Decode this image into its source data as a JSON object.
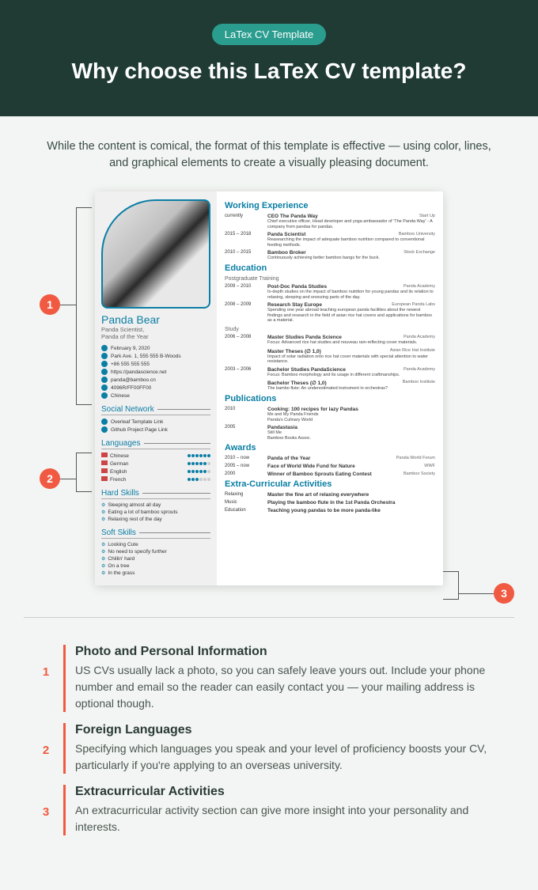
{
  "header": {
    "badge": "LaTex CV Template",
    "headline": "Why choose this LaTeX CV template?"
  },
  "intro": "While the content is comical, the format of this template is effective — using color, lines, and graphical elements to create a visually pleasing document.",
  "cv": {
    "name": "Panda Bear",
    "subtitle": "Panda Scientist,\nPanda of the Year",
    "contacts": [
      "February 9, 2020",
      "Park Ave. 1, 555 555 B-Woods",
      "+86 555 555 555",
      "https://pandascience.net",
      "panda@bamboo.cn",
      "4096R/FF00FF00",
      "Chinese"
    ],
    "sections_left": {
      "social": {
        "title": "Social Network",
        "items": [
          "Overleaf Template Link",
          "Github Project Page Link"
        ]
      },
      "languages": {
        "title": "Languages",
        "items": [
          {
            "name": "Chinese",
            "level": 6
          },
          {
            "name": "German",
            "level": 5
          },
          {
            "name": "English",
            "level": 5
          },
          {
            "name": "French",
            "level": 3
          }
        ]
      },
      "hard": {
        "title": "Hard Skills",
        "items": [
          "Sleeping almost all day",
          "Eating a lot of bamboo sprouts",
          "Relaxing rest of the day"
        ]
      },
      "soft": {
        "title": "Soft Skills",
        "items": [
          "Looking Cute",
          "No need to specify further",
          "Chillin' hard",
          "On a tree",
          "In the grass"
        ]
      }
    },
    "right": {
      "work": {
        "title": "Working Experience",
        "entries": [
          {
            "date": "currently",
            "title": "CEO The Panda Way",
            "org": "Start Up",
            "desc": "Chief executive officer, Head developer and yoga ambassador of 'The Panda Way' - A company from pandas for pandas."
          },
          {
            "date": "2015 – 2018",
            "title": "Panda Scientist",
            "org": "Bamboo University",
            "desc": "Reasearching the impact of adequate bamboo nutrition compared to conventional feeding methods."
          },
          {
            "date": "2010 – 2015",
            "title": "Bamboo Broker",
            "org": "Stock Exchange",
            "desc": "Continuously achieving better bamboo bangs for the buck."
          }
        ]
      },
      "education": {
        "title": "Education",
        "post": "Postgraduate Training",
        "post_entries": [
          {
            "date": "2009 – 2010",
            "title": "Post-Doc Panda Studies",
            "org": "Panda Academy",
            "desc": "In-depth studies on the impact of bamboo nutrition for young pandas and its relation to relaxing, sleeping and snoozing parts of the day."
          },
          {
            "date": "2008 – 2009",
            "title": "Research Stay Europe",
            "org": "European Panda Labs",
            "desc": "Spending one year abroad teaching european panda facilities about the newest findings and research in the field of asian rice hat covers and applications for bamboo as a material."
          }
        ],
        "study": "Study",
        "study_entries": [
          {
            "date": "2006 – 2008",
            "title": "Master Studies Panda Science",
            "org": "Panda Academy",
            "desc": "Focus: Advanced rice hat studies and nouveau rain-reflecting cover materials."
          },
          {
            "date": "",
            "title": "Master Theses (∅ 1,0)",
            "org": "Asian Rice Hat Institute",
            "desc": "Impact of solar radiation onto rice hat cover materials with special attention to water resistance."
          },
          {
            "date": "2003 – 2006",
            "title": "Bachelor Studies PandaScience",
            "org": "Panda Academy",
            "desc": "Focus: Bamboo morphology and its usage in different craftmanships."
          },
          {
            "date": "",
            "title": "Bachelor Theses (∅ 1,0)",
            "org": "Bamboo Institute",
            "desc": "The bambo flute: An underestimated instrument in orchestras?"
          }
        ]
      },
      "publications": {
        "title": "Publications",
        "entries": [
          {
            "date": "2010",
            "title": "Cooking: 100 recipes for lazy Pandas",
            "desc": "Me and My Panda Friends\nPanda's Culinary World"
          },
          {
            "date": "2005",
            "title": "Pandastasia",
            "desc": "Still Me\nBamboo Books Assoc."
          }
        ]
      },
      "awards": {
        "title": "Awards",
        "entries": [
          {
            "date": "2010 – now",
            "title": "Panda of the Year",
            "org": "Panda World Forum"
          },
          {
            "date": "2005 – now",
            "title": "Face of World Wide Fund for Nature",
            "org": "WWF"
          },
          {
            "date": "2000",
            "title": "Winner of Bamboo Sprouts Eating Contest",
            "org": "Bamboo Society"
          }
        ]
      },
      "extra": {
        "title": "Extra-Curricular Activities",
        "entries": [
          {
            "date": "Relaxing",
            "title": "Master the fine art of relaxing everywhere"
          },
          {
            "date": "Music",
            "title": "Playing the bamboo flute in the 1st Panda Orchestra"
          },
          {
            "date": "Education",
            "title": "Teaching young pandas to be more panda-like"
          }
        ]
      }
    }
  },
  "explanations": [
    {
      "num": "1",
      "title": "Photo and Personal Information",
      "text": "US CVs usually lack a photo, so you can safely leave yours out. Include your phone number and email so the reader can easily contact you — your mailing address is optional though."
    },
    {
      "num": "2",
      "title": "Foreign Languages",
      "text": "Specifying which languages you speak and your level of proficiency boosts your CV, particularly if you're applying to an overseas university."
    },
    {
      "num": "3",
      "title": "Extracurricular Activities",
      "text": "An extracurricular activity section can give more insight into your personality and interests."
    }
  ]
}
